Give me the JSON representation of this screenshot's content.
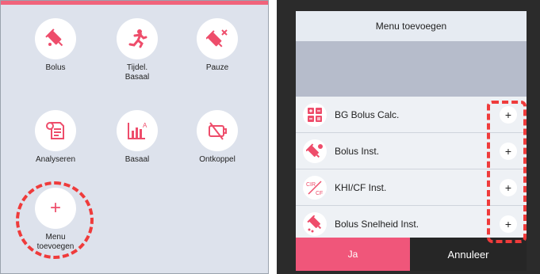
{
  "left": {
    "tiles": [
      {
        "label": "Bolus",
        "icon": "bolus-syringe-icon"
      },
      {
        "label": "Tijdel.\nBasaal",
        "icon": "running-person-icon"
      },
      {
        "label": "Pauze",
        "icon": "pause-syringe-icon"
      },
      {
        "label": "Analyseren",
        "icon": "document-analysis-icon"
      },
      {
        "label": "Basaal",
        "icon": "basal-chart-icon"
      },
      {
        "label": "Ontkoppel",
        "icon": "disconnect-icon"
      }
    ],
    "add_tile": {
      "label": "Menu\ntoevoegen",
      "symbol": "+"
    }
  },
  "dialog": {
    "title": "Menu toevoegen",
    "items": [
      {
        "label": "BG Bolus Calc.",
        "icon": "calculator-icon",
        "add": "+"
      },
      {
        "label": "Bolus Inst.",
        "icon": "bolus-settings-icon",
        "add": "+"
      },
      {
        "label": "KHI/CF Inst.",
        "icon": "cir-cf-icon",
        "icon_text_top": "CIR",
        "icon_text_bottom": "CF",
        "add": "+"
      },
      {
        "label": "Bolus Snelheid Inst.",
        "icon": "bolus-speed-icon",
        "add": "+"
      }
    ],
    "confirm_label": "Ja",
    "cancel_label": "Annuleer"
  },
  "colors": {
    "accent": "#f0567a",
    "highlight": "#ef3b3b",
    "panel_bg": "#dde2ec",
    "dark_bg": "#2b2b2b"
  }
}
